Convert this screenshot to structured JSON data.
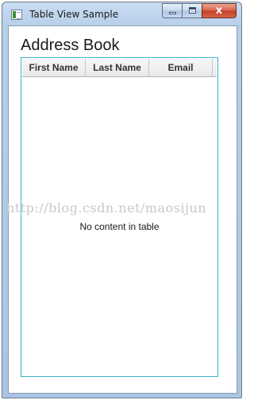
{
  "window": {
    "title": "Table View Sample",
    "close_glyph": "x",
    "icons": {
      "app": "app-window-icon",
      "minimize": "minimize-icon",
      "maximize": "maximize-icon",
      "close": "close-icon"
    }
  },
  "page": {
    "title": "Address Book"
  },
  "table": {
    "columns": [
      "First Name",
      "Last Name",
      "Email"
    ],
    "rows": [],
    "placeholder": "No content in table"
  },
  "watermark": "http://blog.csdn.net/maosijun",
  "colors": {
    "table_border": "#3bb3c8",
    "close_button": "#c23e22"
  }
}
